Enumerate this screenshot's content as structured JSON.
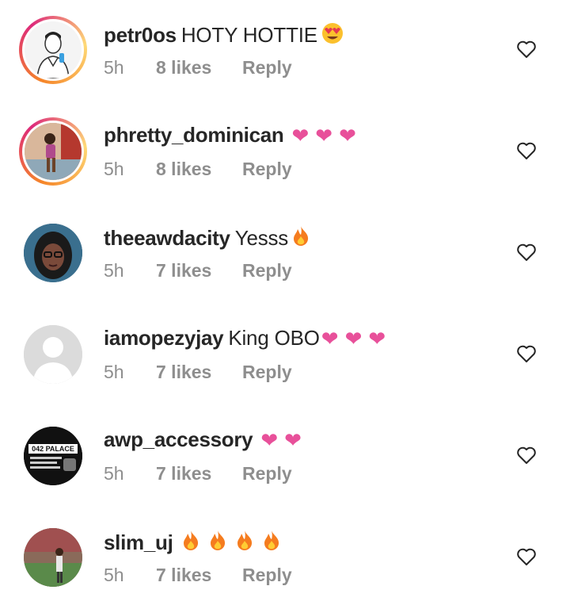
{
  "comments": [
    {
      "username": "petr0os",
      "text": "HOTY HOTTIE",
      "emoji": "heart-eyes-emoji",
      "time": "5h",
      "likes": "8 likes",
      "reply": "Reply",
      "avatar": "man-illustration"
    },
    {
      "username": "phretty_dominican",
      "text": "",
      "emoji": "heart-x3",
      "time": "5h",
      "likes": "8 likes",
      "reply": "Reply",
      "avatar": "woman-photo"
    },
    {
      "username": "theeawdacity",
      "text": "Yesss",
      "emoji": "fire-emoji",
      "time": "5h",
      "likes": "7 likes",
      "reply": "Reply",
      "avatar": "woman-glasses-photo"
    },
    {
      "username": "iamopezyjay",
      "text": "King OBO",
      "emoji": "heart-x3",
      "time": "5h",
      "likes": "7 likes",
      "reply": "Reply",
      "avatar": "default-avatar"
    },
    {
      "username": "awp_accessory",
      "text": "",
      "emoji": "heart-x2",
      "time": "5h",
      "likes": "7 likes",
      "reply": "Reply",
      "avatar": "042-palace-logo"
    },
    {
      "username": "slim_uj",
      "text": "",
      "emoji": "fire-x4",
      "time": "5h",
      "likes": "7 likes",
      "reply": "Reply",
      "avatar": "man-outdoor-photo"
    }
  ],
  "logo_text": "042 PALACE",
  "colors": {
    "heart": "#e8509a",
    "muted": "#8e8e8e",
    "text": "#262626"
  }
}
